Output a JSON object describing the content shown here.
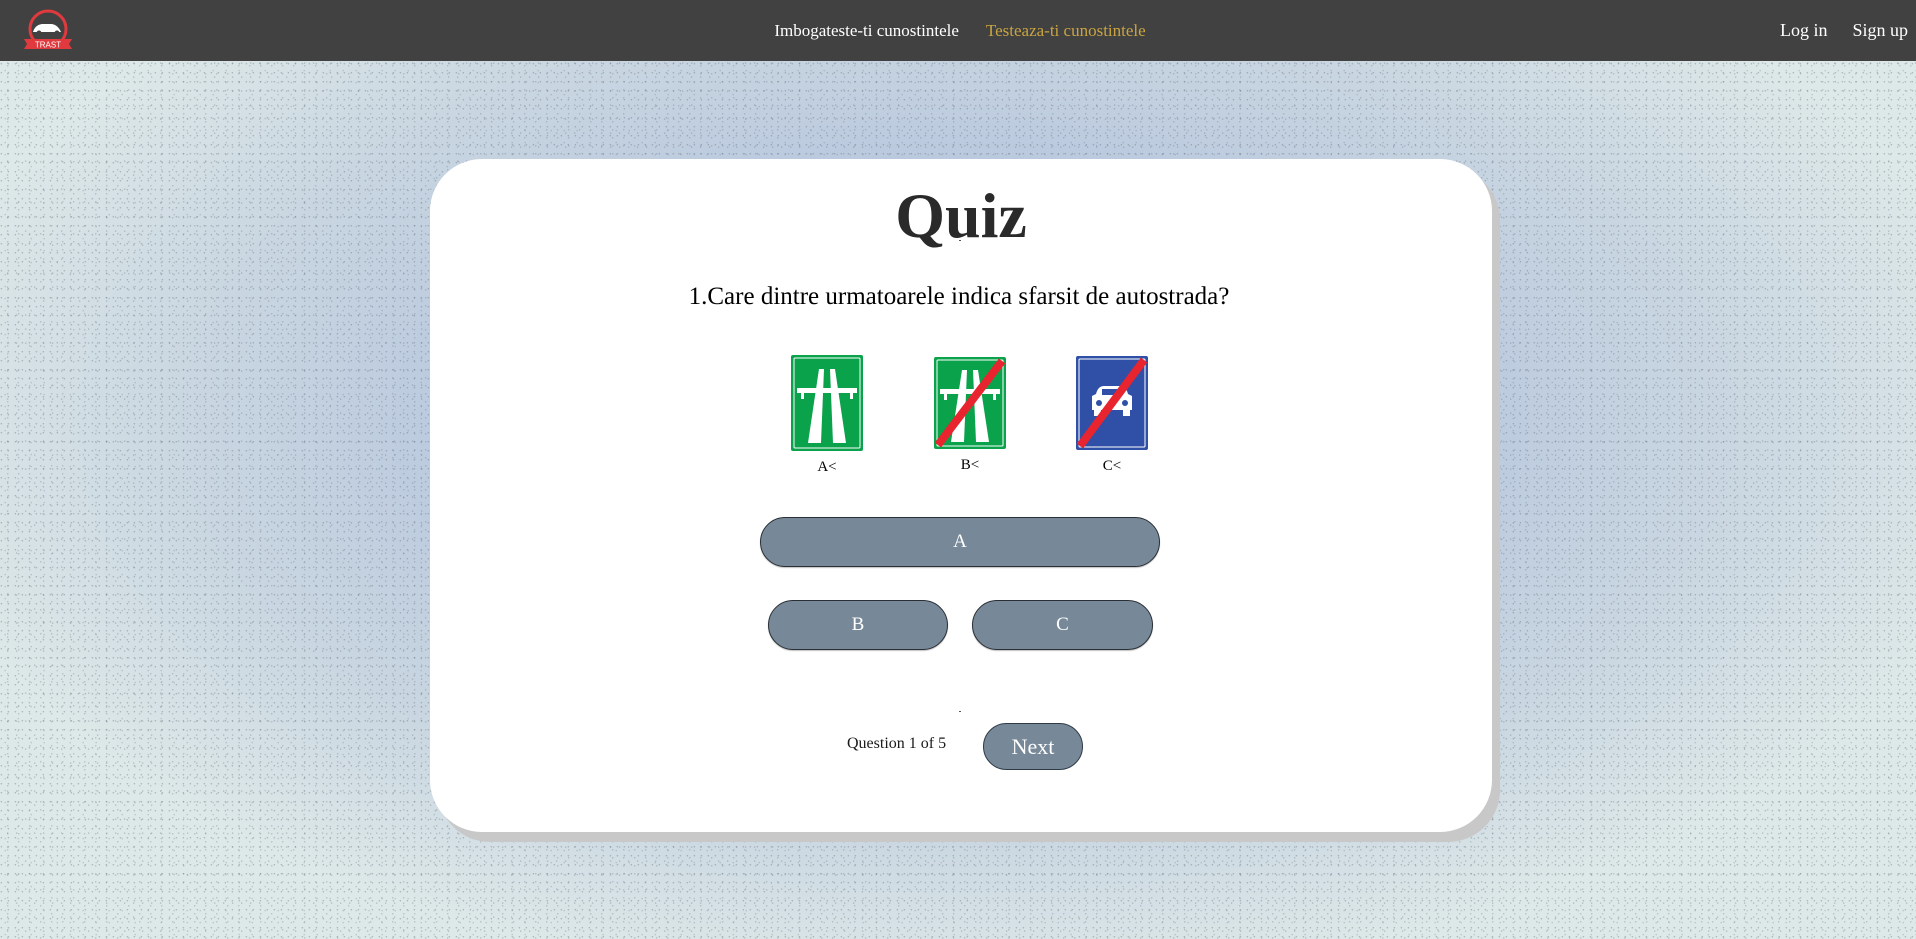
{
  "navbar": {
    "logo_text": "TRAST",
    "links": [
      {
        "label": "Imbogateste-ti cunostintele",
        "active": false
      },
      {
        "label": "Testeaza-ti cunostintele",
        "active": true
      }
    ],
    "login_label": "Log in",
    "signup_label": "Sign up",
    "active_color": "#c9a441"
  },
  "quiz": {
    "title": "Quiz",
    "question": "1.Care dintre urmatoarele indica sfarsit de autostrada?",
    "signs": [
      {
        "icon": "motorway-sign-icon",
        "label": "A<"
      },
      {
        "icon": "end-of-motorway-sign-icon",
        "label": "B<"
      },
      {
        "icon": "end-of-expressway-sign-icon",
        "label": "C<"
      }
    ],
    "answers": {
      "a": "A",
      "b": "B",
      "c": "C"
    },
    "progress_label": "Question",
    "current_question": "1",
    "of_label": "of",
    "total_questions": "5",
    "next_label": "Next"
  },
  "colors": {
    "navbar_bg": "#414141",
    "button_bg": "#778999",
    "sign_green": "#0aa24b",
    "sign_blue": "#2f50a6",
    "sign_red": "#e8242f"
  }
}
